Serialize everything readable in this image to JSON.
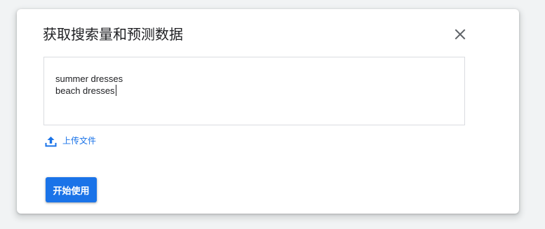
{
  "dialog": {
    "title": "获取搜索量和预测数据",
    "close_icon": "close-icon",
    "keywords_input": {
      "lines": [
        "summer dresses",
        "beach dresses"
      ]
    },
    "upload": {
      "icon": "upload-icon",
      "label": "上传文件"
    },
    "start_button": {
      "label": "开始使用"
    }
  },
  "colors": {
    "primary": "#1a73e8",
    "text": "#202124",
    "border": "#dadce0",
    "backdrop": "#f1f3f4"
  }
}
